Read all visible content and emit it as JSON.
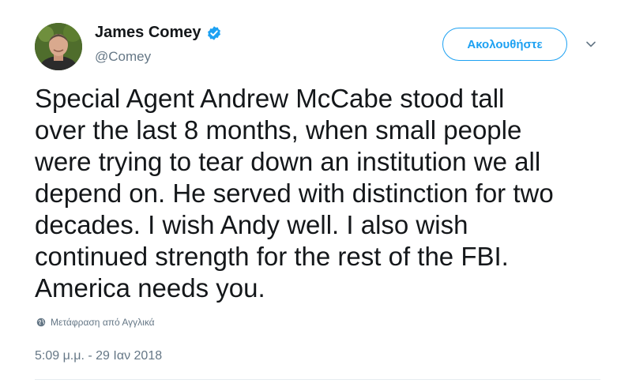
{
  "user": {
    "display_name": "James Comey",
    "handle": "@Comey",
    "verified": true
  },
  "actions": {
    "follow_label": "Ακολουθήστε"
  },
  "tweet": {
    "text": "Special Agent Andrew McCabe stood tall\nover the last 8 months, when small people\nwere trying to tear down an institution we all\ndepend on. He served with distinction for two\ndecades. I wish Andy well. I also wish\ncontinued strength for the rest of the FBI.\nAmerica needs you.",
    "translate_label": "Μετάφραση από Αγγλικά",
    "timestamp": "5:09 μ.μ. - 29 Ιαν 2018"
  },
  "colors": {
    "accent": "#1da1f2",
    "text": "#14171a",
    "secondary": "#657786",
    "divider": "#e6ecf0"
  },
  "icons": {
    "verified": "verified-badge-icon",
    "caret": "chevron-down-icon",
    "globe": "globe-icon"
  }
}
